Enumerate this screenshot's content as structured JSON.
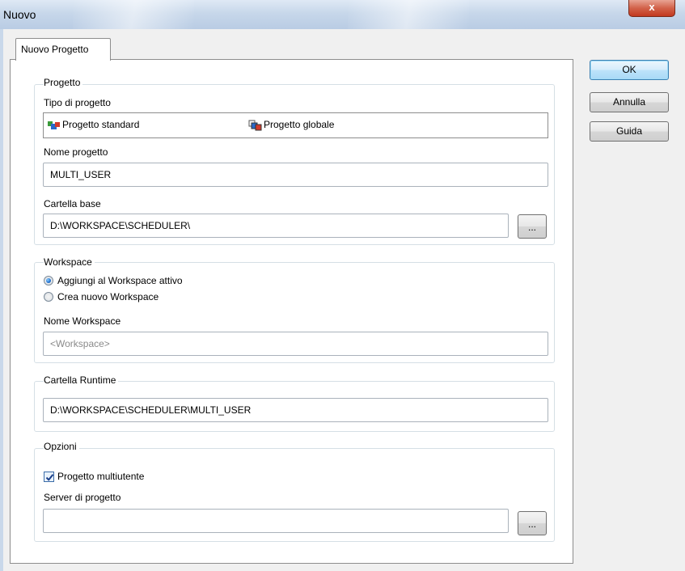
{
  "window": {
    "title": "Nuovo",
    "close_glyph": "x"
  },
  "tab": {
    "label": "Nuovo Progetto"
  },
  "buttons": {
    "ok": "OK",
    "cancel": "Annulla",
    "help": "Guida"
  },
  "progetto": {
    "legend": "Progetto",
    "type_label": "Tipo di progetto",
    "types": [
      {
        "label": "Progetto standard",
        "icon": "standard-project-icon"
      },
      {
        "label": "Progetto globale",
        "icon": "global-project-icon"
      }
    ],
    "name_label": "Nome progetto",
    "name_value": "MULTI_USER",
    "base_label": "Cartella base",
    "base_value": "D:\\WORKSPACE\\SCHEDULER\\",
    "browse": "..."
  },
  "workspace": {
    "legend": "Workspace",
    "options": [
      {
        "label": "Aggiungi al Workspace attivo",
        "selected": true
      },
      {
        "label": "Crea nuovo Workspace",
        "selected": false
      }
    ],
    "name_label": "Nome Workspace",
    "name_placeholder": "<Workspace>"
  },
  "runtime": {
    "legend": "Cartella Runtime",
    "value": "D:\\WORKSPACE\\SCHEDULER\\MULTI_USER"
  },
  "opzioni": {
    "legend": "Opzioni",
    "multiuser_label": "Progetto multiutente",
    "multiuser_checked": true,
    "server_label": "Server di progetto",
    "server_value": "",
    "browse": "..."
  },
  "colors": {
    "accent": "#3c7fb1",
    "close": "#c2391f",
    "titlebar": "#c7d7ea"
  }
}
